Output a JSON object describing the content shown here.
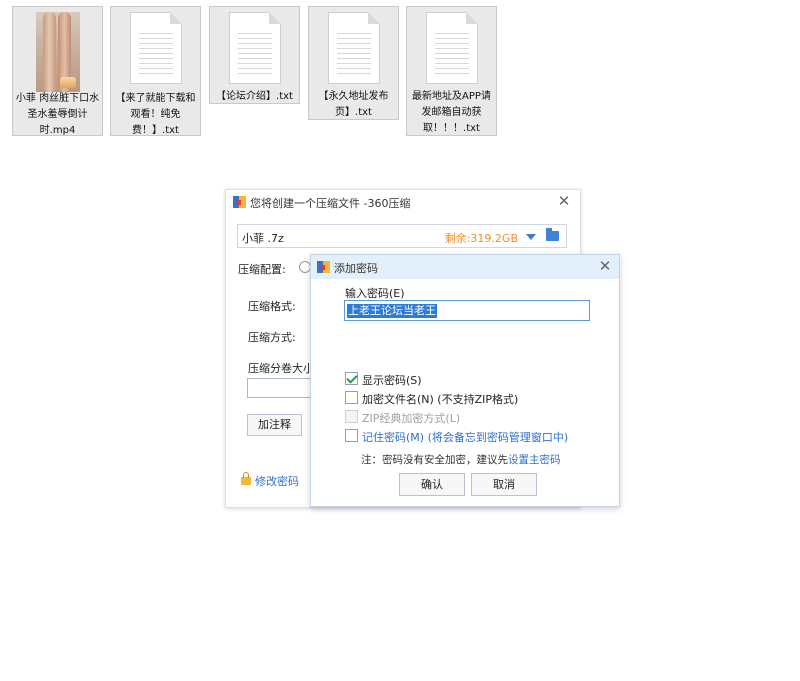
{
  "files": [
    {
      "name": "小菲 肉丝脏下口水圣水羞辱倒计时.mp4",
      "type": "video"
    },
    {
      "name": "【来了就能下载和观看！纯免费！】.txt",
      "type": "text"
    },
    {
      "name": "【论坛介绍】.txt",
      "type": "text"
    },
    {
      "name": "【永久地址发布页】.txt",
      "type": "text"
    },
    {
      "name": "最新地址及APP请发邮箱自动获取！！！.txt",
      "type": "text"
    }
  ],
  "compress_window": {
    "title": "您将创建一个压缩文件 -360压缩",
    "path": "小菲 .7z",
    "free_space": "剩余:319.2GB",
    "config_label": "压缩配置:",
    "format_label": "压缩格式:",
    "method_label": "压缩方式:",
    "split_label": "压缩分卷大小",
    "comment_button": "加注释",
    "change_password": "修改密码"
  },
  "password_dialog": {
    "title": "添加密码",
    "input_label": "输入密码(E)",
    "password_value": "上老王论坛当老王",
    "show_password": "显示密码(S)",
    "encrypt_filenames": "加密文件名(N) (不支持ZIP格式)",
    "zip_classic": "ZIP经典加密方式(L)",
    "remember_password": "记住密码(M) (将会备忘到密码管理窗口中)",
    "note": "注：密码没有安全加密，建议先",
    "note_link": "设置主密码",
    "ok_button": "确认",
    "cancel_button": "取消"
  },
  "colors": {
    "accent": "#2f6fd0",
    "free_space": "#f0902a",
    "dialog_title_bg": "#e3effb"
  }
}
